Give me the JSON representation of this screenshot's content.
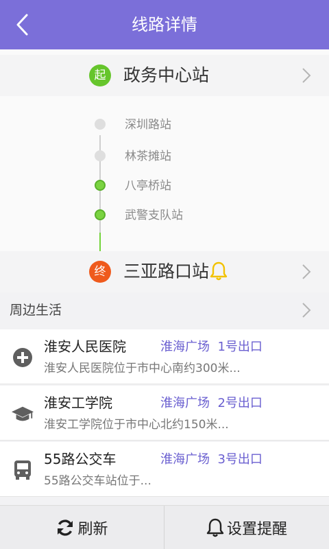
{
  "header": {
    "title": "线路详情",
    "back_icon": "chevron-left-icon"
  },
  "route": {
    "start": {
      "badge": "起",
      "name": "政务中心站",
      "color": "#66c52c"
    },
    "end": {
      "badge": "终",
      "name": "三亚路口站",
      "color": "#ef5a1c",
      "alert_icon": "bell-icon"
    },
    "stops": [
      {
        "name": "深圳路站",
        "state": "pending"
      },
      {
        "name": "林茶摊站",
        "state": "pending"
      },
      {
        "name": "八亭桥站",
        "state": "passed"
      },
      {
        "name": "武警支队站",
        "state": "passed"
      }
    ]
  },
  "nearby": {
    "title": "周边生活",
    "items": [
      {
        "icon": "medical-plus-icon",
        "name": "淮安人民医院",
        "location": "淮海广场",
        "exit": "1号出口",
        "description": "淮安人民医院位于市中心南约300米..."
      },
      {
        "icon": "graduation-cap-icon",
        "name": "淮安工学院",
        "location": "淮海广场",
        "exit": "2号出口",
        "description": "淮安工学院位于市中心北约150米..."
      },
      {
        "icon": "bus-icon",
        "name": "55路公交车",
        "location": "淮海广场",
        "exit": "3号出口",
        "description": "55路公交车站位于..."
      }
    ]
  },
  "bottom": {
    "refresh_label": "刷新",
    "remind_label": "设置提醒"
  },
  "colors": {
    "accent": "#7b6fd9",
    "link": "#6a5fd0",
    "passed": "#72d33a"
  }
}
